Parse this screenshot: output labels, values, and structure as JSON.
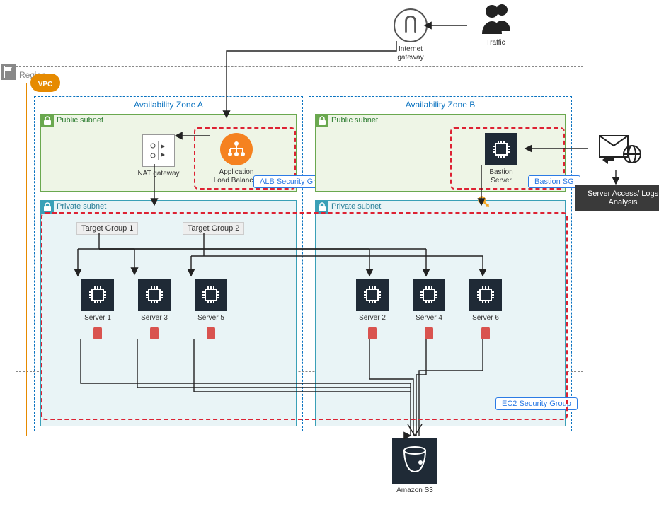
{
  "top": {
    "igw": "Internet\ngateway",
    "traffic": "Traffic"
  },
  "region": {
    "label": "Region",
    "vpc": "VPC"
  },
  "az": {
    "a": "Availability Zone A",
    "b": "Availability Zone B"
  },
  "subnets": {
    "publicA": "Public subnet",
    "publicB": "Public subnet",
    "privateA": "Private subnet",
    "privateB": "Private subnet"
  },
  "alb": {
    "label": "Application\nLoad Balancer",
    "sg": "ALB Security Group"
  },
  "nat": "NAT gateway",
  "bastion": {
    "label": "Bastion\nServer",
    "sg": "Bastion SG"
  },
  "tg": {
    "1": "Target Group 1",
    "2": "Target Group 2"
  },
  "servers": {
    "s1": "Server 1",
    "s2": "Server 2",
    "s3": "Server 3",
    "s4": "Server 4",
    "s5": "Server 5",
    "s6": "Server 6"
  },
  "ec2_sg": "EC2 Security Group",
  "s3": "Amazon S3",
  "external": {
    "logs": "Server Access/ Logs\nAnalysis"
  }
}
